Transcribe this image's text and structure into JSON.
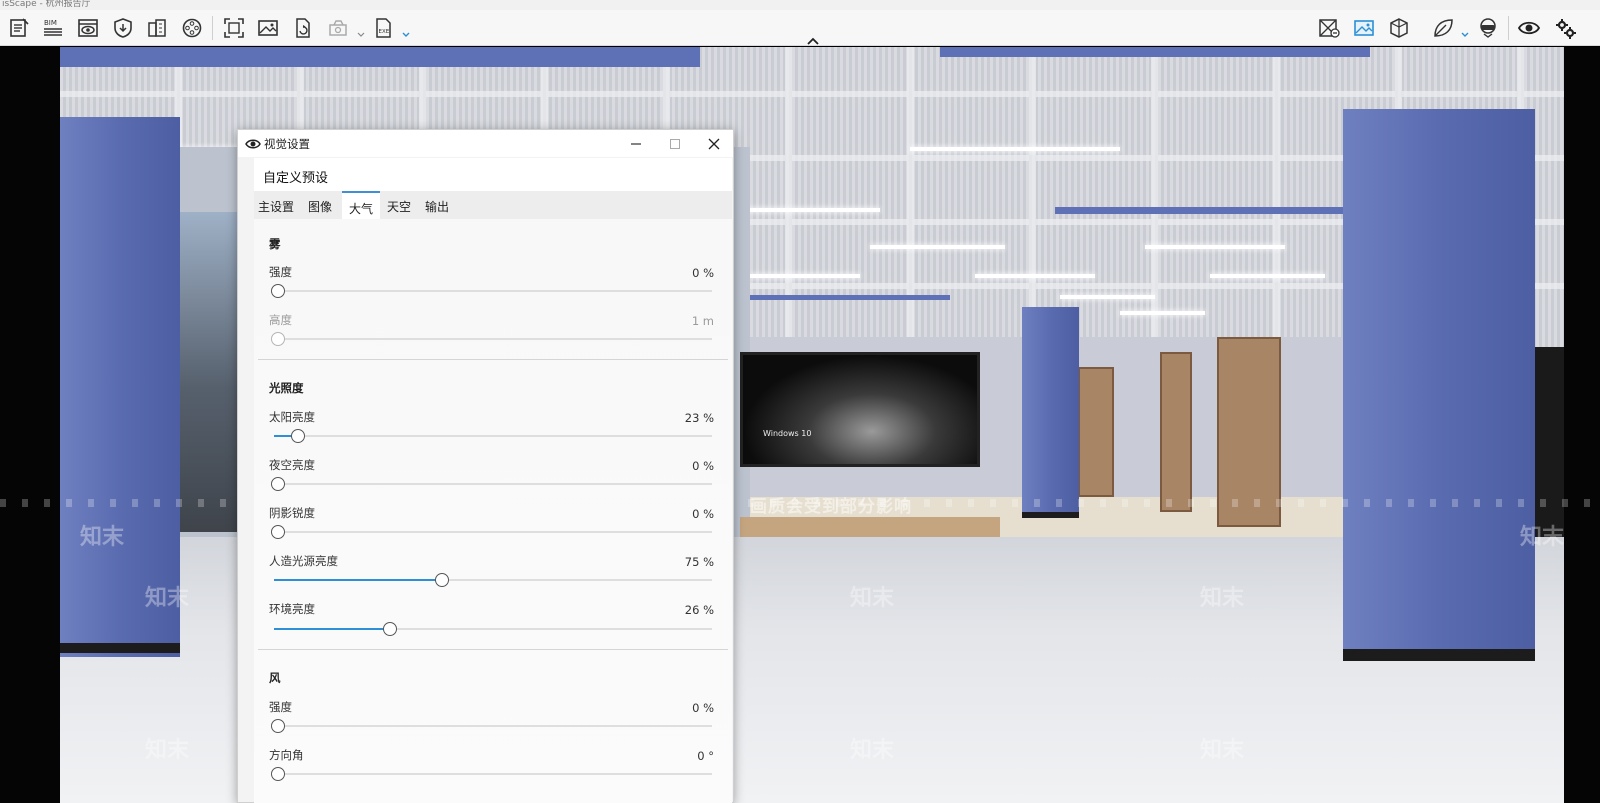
{
  "window_title": "isScape - 杭州报告厅",
  "toolbar": {
    "left_tools": [
      {
        "icon": "document-edit-icon",
        "label": ""
      },
      {
        "icon": "bim-icon",
        "label": "BIM"
      },
      {
        "icon": "eye-frame-icon",
        "label": ""
      },
      {
        "icon": "shield-download-icon",
        "label": ""
      },
      {
        "icon": "building-icon",
        "label": ""
      },
      {
        "icon": "film-reel-icon",
        "label": ""
      },
      {
        "icon": "capture-frame-icon",
        "label": ""
      },
      {
        "icon": "image-icon",
        "label": ""
      },
      {
        "icon": "file-refresh-icon",
        "label": ""
      },
      {
        "icon": "camera-3d-icon",
        "label": ""
      },
      {
        "icon": "export-exe-icon",
        "label": "EXE"
      }
    ],
    "right_tools": [
      {
        "icon": "map-x-icon"
      },
      {
        "icon": "image-active-icon"
      },
      {
        "icon": "cube-section-icon"
      },
      {
        "icon": "leaf-icon"
      },
      {
        "icon": "vr-headset-icon"
      },
      {
        "icon": "eye-icon"
      },
      {
        "icon": "settings-icon"
      }
    ],
    "accent_color": "#2b8fd6"
  },
  "viewport": {
    "notice": "画质会受到部分影响",
    "watermark": "知末",
    "screen_text": "Windows 10"
  },
  "dialog": {
    "title": "视觉设置",
    "preset": "自定义预设",
    "tabs": [
      "主设置",
      "图像",
      "大气",
      "天空",
      "输出"
    ],
    "active_tab": "大气",
    "sections": {
      "fog": {
        "title": "雾",
        "rows": [
          {
            "label": "强度",
            "value": "0 %",
            "level": 0,
            "disabled": false
          },
          {
            "label": "高度",
            "value": "1 m",
            "level": 0,
            "disabled": true
          }
        ]
      },
      "lighting": {
        "title": "光照度",
        "rows": [
          {
            "label": "太阳亮度",
            "value": "23 %",
            "level": 0.05,
            "disabled": false
          },
          {
            "label": "夜空亮度",
            "value": "0 %",
            "level": 0,
            "disabled": false
          },
          {
            "label": "阴影锐度",
            "value": "0 %",
            "level": 0,
            "disabled": false
          },
          {
            "label": "人造光源亮度",
            "value": "75 %",
            "level": 0.38,
            "disabled": false
          },
          {
            "label": "环境亮度",
            "value": "26 %",
            "level": 0.26,
            "disabled": false
          }
        ]
      },
      "wind": {
        "title": "风",
        "rows": [
          {
            "label": "强度",
            "value": "0 %",
            "level": 0,
            "disabled": false
          },
          {
            "label": "方向角",
            "value": "0 °",
            "level": 0,
            "disabled": false
          }
        ]
      }
    }
  }
}
